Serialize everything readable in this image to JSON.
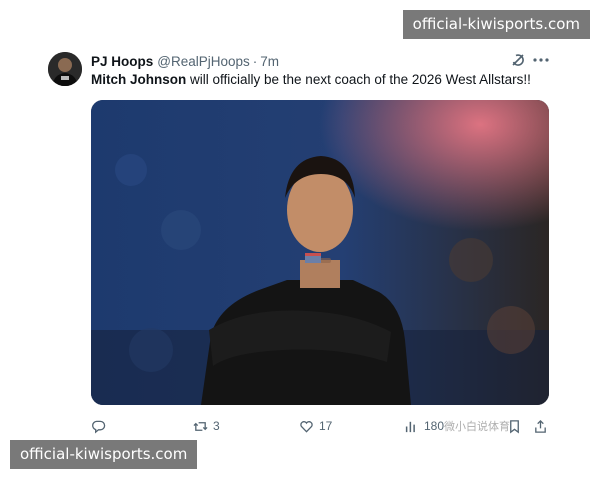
{
  "watermark": {
    "text": "official-kiwisports.com"
  },
  "tweet": {
    "display_name": "PJ Hoops",
    "handle": "@RealPjHoops",
    "separator": "·",
    "time": "7m",
    "text_mention": "Mitch Johnson",
    "text_body": " will officially be the next coach of the 2026 West Allstars!!",
    "actions": {
      "replies": "",
      "retweets": "3",
      "likes": "17",
      "views": "180"
    }
  },
  "overlay": {
    "weibo_text": "微小白说体育"
  },
  "icons": {
    "avatar": "profile-avatar",
    "grok": "grok-icon",
    "more": "more-icon",
    "reply": "reply-icon",
    "retweet": "retweet-icon",
    "like": "heart-icon",
    "views": "views-icon",
    "bookmark": "bookmark-icon",
    "share": "share-icon"
  },
  "colors": {
    "text": "#0f1419",
    "muted": "#536471",
    "watermark_bg": "#6f6f6f"
  }
}
